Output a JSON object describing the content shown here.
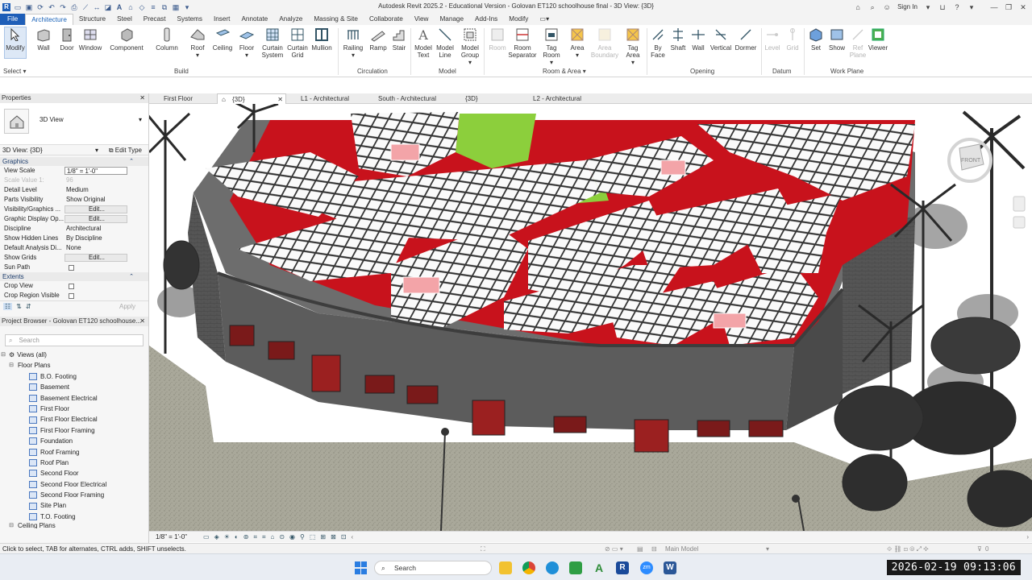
{
  "window": {
    "title": "Autodesk Revit 2025.2 - Educational Version - Golovan ET120 schoolhouse final - 3D View: {3D}"
  },
  "titlebar": {
    "sign_in": "Sign In"
  },
  "ribbon_tabs": [
    "File",
    "Architecture",
    "Structure",
    "Steel",
    "Precast",
    "Systems",
    "Insert",
    "Annotate",
    "Analyze",
    "Massing & Site",
    "Collaborate",
    "View",
    "Manage",
    "Add-Ins",
    "Modify"
  ],
  "ribbon": {
    "select_label": "Select",
    "tools": {
      "modify": "Modify",
      "wall": "Wall",
      "door": "Door",
      "window": "Window",
      "component": "Component",
      "column": "Column",
      "roof": "Roof",
      "ceiling": "Ceiling",
      "floor": "Floor",
      "curtain_system": "Curtain System",
      "curtain_grid": "Curtain Grid",
      "mullion": "Mullion",
      "railing": "Railing",
      "ramp": "Ramp",
      "stair": "Stair",
      "model_text": "Model Text",
      "model_line": "Model Line",
      "model_group": "Model Group",
      "room": "Room",
      "room_separator": "Room Separator",
      "tag_room": "Tag Room",
      "area": "Area",
      "area_boundary": "Area Boundary",
      "tag_area": "Tag Area",
      "by_face": "By Face",
      "shaft": "Shaft",
      "wall_opening": "Wall",
      "vertical": "Vertical",
      "dormer": "Dormer",
      "level": "Level",
      "grid": "Grid",
      "set": "Set",
      "show": "Show",
      "ref_plane": "Ref Plane",
      "viewer": "Viewer"
    },
    "groups": {
      "build": "Build",
      "circulation": "Circulation",
      "model": "Model",
      "room_area": "Room & Area",
      "opening": "Opening",
      "datum": "Datum",
      "work_plane": "Work Plane"
    }
  },
  "properties": {
    "header": "Properties",
    "type_name": "3D View",
    "instance_label": "3D View: {3D}",
    "edit_type": "Edit Type",
    "sections": {
      "graphics": "Graphics",
      "extents": "Extents"
    },
    "rows": [
      {
        "key": "View Scale",
        "value": "1/8\" = 1'-0\""
      },
      {
        "key": "Scale Value    1:",
        "value": "96"
      },
      {
        "key": "Detail Level",
        "value": "Medium"
      },
      {
        "key": "Parts Visibility",
        "value": "Show Original"
      },
      {
        "key": "Visibility/Graphics ...",
        "value": "Edit..."
      },
      {
        "key": "Graphic Display Op...",
        "value": "Edit..."
      },
      {
        "key": "Discipline",
        "value": "Architectural"
      },
      {
        "key": "Show Hidden Lines",
        "value": "By Discipline"
      },
      {
        "key": "Default Analysis Di...",
        "value": "None"
      },
      {
        "key": "Show Grids",
        "value": "Edit..."
      },
      {
        "key": "Sun Path",
        "value": ""
      }
    ],
    "extents_rows": [
      {
        "key": "Crop View"
      },
      {
        "key": "Crop Region Visible"
      }
    ],
    "apply": "Apply"
  },
  "project_browser": {
    "header": "Project Browser - Golovan ET120 schoolhouse...",
    "search_placeholder": "Search",
    "views_all": "Views (all)",
    "floor_plans": "Floor Plans",
    "items": [
      "B.O. Footing",
      "Basement",
      "Basement Electrical",
      "First Floor",
      "First Floor Electrical",
      "First Floor Framing",
      "Foundation",
      "Roof Framing",
      "Roof Plan",
      "Second Floor",
      "Second Floor Electrical",
      "Second Floor Framing",
      "Site Plan",
      "T.O. Footing"
    ],
    "ceiling_plans": "Ceiling Plans"
  },
  "view_tabs": [
    "First Floor",
    "{3D}",
    "L1 - Architectural",
    "South - Architectural",
    "{3D}",
    "L2 - Architectural"
  ],
  "view_control": {
    "scale": "1/8\" = 1'-0\""
  },
  "status": {
    "hint": "Click to select, TAB for alternates, CTRL adds, SHIFT unselects.",
    "main_model": "Main Model",
    "filter_count": "0"
  },
  "taskbar": {
    "search": "Search"
  },
  "clock": "2026-02-19  09:13:06",
  "colors": {
    "roof_red": "#c8121c",
    "roof_green": "#8ccf3c",
    "wall_grey": "#5c5c5c",
    "ground": "#a9a89a",
    "accent": "#1e5eb8"
  }
}
